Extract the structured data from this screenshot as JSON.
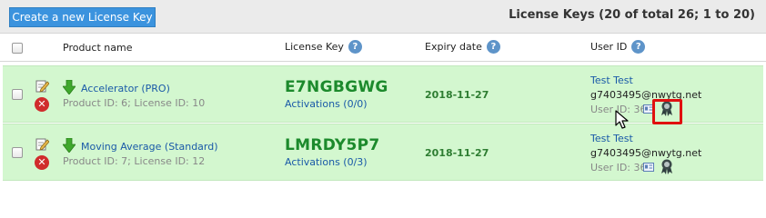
{
  "toolbar": {
    "create_button_label": "Create a new License Key",
    "title": "License Keys (20 of total 26; 1 to 20)"
  },
  "table": {
    "columns": {
      "product": "Product name",
      "license_key": "License Key",
      "expiry": "Expiry date",
      "user_id": "User ID"
    },
    "help_glyph": "?",
    "rows": [
      {
        "product_name": "Accelerator (PRO)",
        "product_meta": "Product ID: 6; License ID: 10",
        "license_key": "E7NGBGWG",
        "activations": "Activations (0/0)",
        "expiry": "2018-11-27",
        "user_name": "Test Test",
        "user_email": "g7403495@nwytg.net",
        "user_id_text": "User ID: 36"
      },
      {
        "product_name": "Moving Average (Standard)",
        "product_meta": "Product ID: 7; License ID: 12",
        "license_key": "LMRDY5P7",
        "activations": "Activations (0/3)",
        "expiry": "2018-11-27",
        "user_name": "Test Test",
        "user_email": "g7403495@nwytg.net",
        "user_id_text": "User ID: 36"
      }
    ]
  },
  "icons": {
    "delete_glyph": "✕"
  },
  "colors": {
    "accent_button": "#3b93de",
    "row_bg": "#d3f7cf",
    "license_key": "#1c8a2c",
    "link": "#1a5aa8",
    "highlight": "#e01010"
  }
}
